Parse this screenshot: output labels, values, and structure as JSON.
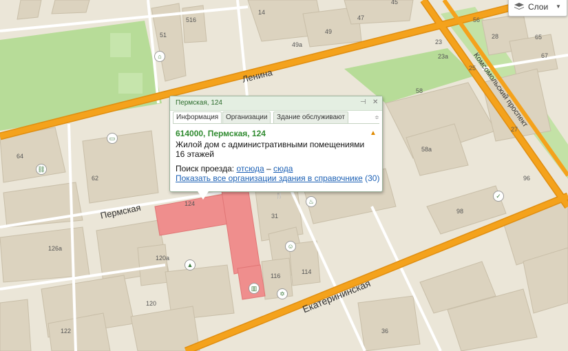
{
  "layers_button": {
    "label": "Слои",
    "icon": "layers-icon"
  },
  "streets": {
    "lenina": "Ленина",
    "permskaya": "Пермская",
    "ekaterininskaya": "Екатерининская",
    "komsomolsky": "Комсомольский проспект"
  },
  "house_numbers": {
    "h14": "14",
    "h47": "47",
    "h45": "45",
    "h56": "56",
    "h28": "28",
    "h65": "65",
    "h67": "67",
    "h51": "51",
    "h516": "516",
    "h49": "49",
    "h49a": "49a",
    "h23": "23",
    "h23a": "23a",
    "h25": "25",
    "h58": "58",
    "h27": "27",
    "h58a": "58a",
    "h96": "96",
    "h98": "98",
    "h64": "64",
    "h62": "62",
    "h124": "124",
    "h31": "31",
    "h126a": "126a",
    "h120a": "120a",
    "h116": "116",
    "h114": "114",
    "h120": "120",
    "h122": "122",
    "h36": "36"
  },
  "balloon": {
    "title": "Пермская, 124",
    "tabs": [
      "Информация",
      "Организации",
      "Здание обслуживают"
    ],
    "address": "614000, Пермская, 124",
    "description": "Жилой дом с административными помещениями",
    "floors": "16 этажей",
    "route_label": "Поиск проезда:",
    "route_from": "отсюда",
    "route_dash": "–",
    "route_to": "сюда",
    "orgs_link": "Показать все организации здания в справочнике",
    "orgs_count": "(30)",
    "warning_icon": "warning-icon"
  },
  "colors": {
    "background": "#ebe6d8",
    "major_road": "#f4a21c",
    "park": "#b7dc98",
    "building": "#dcd3bf",
    "highlight": "#f08a8a",
    "balloon_header": "#e4efe2",
    "address_green": "#2f8a2f",
    "link": "#1a5fb4"
  }
}
